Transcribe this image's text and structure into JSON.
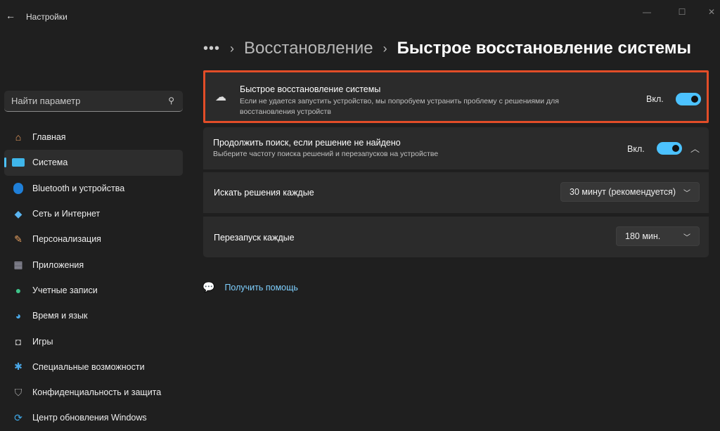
{
  "app": {
    "title": "Настройки"
  },
  "search": {
    "placeholder": "Найти параметр"
  },
  "sidebar": {
    "items": [
      {
        "label": "Главная",
        "icon": "home-icon"
      },
      {
        "label": "Система",
        "icon": "monitor-icon"
      },
      {
        "label": "Bluetooth и устройства",
        "icon": "bluetooth-icon"
      },
      {
        "label": "Сеть и Интернет",
        "icon": "wifi-icon"
      },
      {
        "label": "Персонализация",
        "icon": "brush-icon"
      },
      {
        "label": "Приложения",
        "icon": "apps-icon"
      },
      {
        "label": "Учетные записи",
        "icon": "person-icon"
      },
      {
        "label": "Время и язык",
        "icon": "globe-icon"
      },
      {
        "label": "Игры",
        "icon": "gamepad-icon"
      },
      {
        "label": "Специальные возможности",
        "icon": "accessibility-icon"
      },
      {
        "label": "Конфиденциальность и защита",
        "icon": "shield-icon"
      },
      {
        "label": "Центр обновления Windows",
        "icon": "update-icon"
      }
    ]
  },
  "breadcrumb": {
    "dots": "•••",
    "parent": "Восстановление",
    "current": "Быстрое восстановление системы"
  },
  "quick_recovery": {
    "title": "Быстрое восстановление системы",
    "description": "Если не удается запустить устройство, мы попробуем устранить проблему с решениями для восстановления устройств",
    "state": "Вкл."
  },
  "continue_search": {
    "title": "Продолжить поиск, если решение не найдено",
    "description": "Выберите частоту поиска решений и перезапусков на устройстве",
    "state": "Вкл."
  },
  "search_every": {
    "label": "Искать решения каждые",
    "value": "30 минут (рекомендуется)"
  },
  "restart_every": {
    "label": "Перезапуск каждые",
    "value": "180 мин."
  },
  "help": {
    "label": "Получить помощь"
  }
}
